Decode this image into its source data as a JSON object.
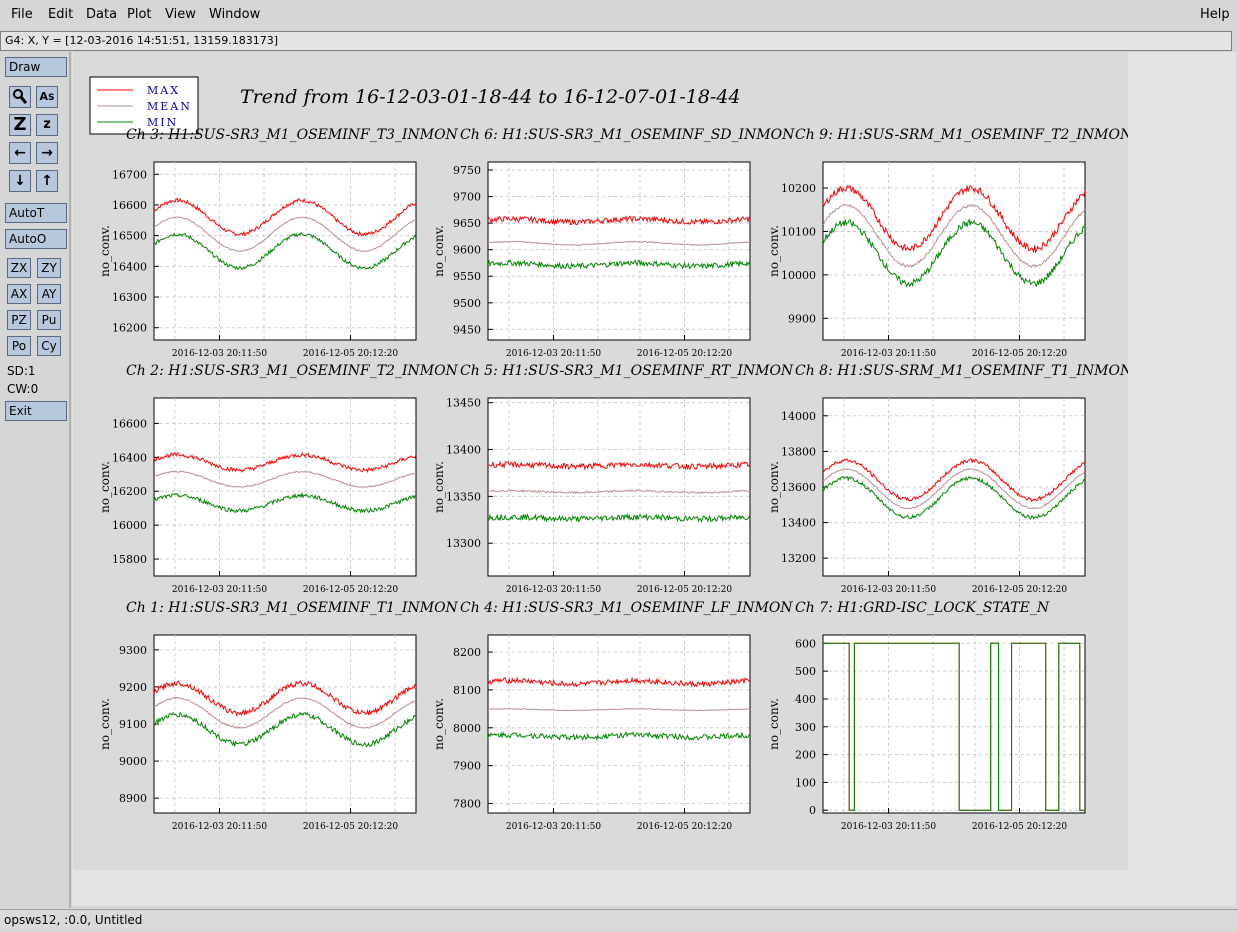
{
  "menu": {
    "file": "File",
    "edit": "Edit",
    "data": "Data",
    "plot": "Plot",
    "view": "View",
    "window": "Window",
    "help": "Help"
  },
  "coord_readout": "G4: X, Y = [12-03-2016 14:51:51, 13159.183173]",
  "toolbar": {
    "draw": "Draw",
    "autot": "AutoT",
    "autoo": "AutoO",
    "zx": "ZX",
    "zy": "ZY",
    "ax": "AX",
    "ay": "AY",
    "pz": "PZ",
    "pu": "Pu",
    "po": "Po",
    "cy": "Cy",
    "sd": "SD:1",
    "cw": "CW:0",
    "exit": "Exit",
    "icons": [
      "zoom-tool-icon",
      "text-tool-icon",
      "zoom-in-icon",
      "zoom-out-icon",
      "pan-left-icon",
      "pan-right-icon",
      "pan-down-icon",
      "pan-up-icon"
    ]
  },
  "status": "opsws12, :0.0, Untitled",
  "colors": {
    "max": "#ff0000",
    "mean": "#bc8f8f",
    "min": "#008800",
    "legend_text": "#0000cc"
  },
  "plot_title": "Trend from 16-12-03-01-18-44 to 16-12-07-01-18-44",
  "legend": [
    "MAX",
    "MEAN",
    "MIN"
  ],
  "chart_data": [
    {
      "type": "line",
      "title": "Ch 3: H1:SUS-SR3_M1_OSEMINF_T3_INMON",
      "ylabel": "no_conv.",
      "xtick_labels": [
        "2016-12-03 20:11:50",
        "2016-12-05 20:12:20"
      ],
      "yticks": [
        16200,
        16300,
        16400,
        16500,
        16600,
        16700
      ],
      "ylim": [
        16160,
        16740
      ],
      "grid": true,
      "series": [
        {
          "name": "MAX",
          "base": 16560,
          "amp": 55,
          "noise": 6
        },
        {
          "name": "MEAN",
          "base": 16505,
          "amp": 55,
          "noise": 2
        },
        {
          "name": "MIN",
          "base": 16450,
          "amp": 55,
          "noise": 6
        }
      ]
    },
    {
      "type": "line",
      "title": "Ch 6: H1:SUS-SR3_M1_OSEMINF_SD_INMON",
      "ylabel": "no_conv.",
      "xtick_labels": [
        "2016-12-03 20:11:50",
        "2016-12-05 20:12:20"
      ],
      "yticks": [
        9450,
        9500,
        9550,
        9600,
        9650,
        9700,
        9750
      ],
      "ylim": [
        9430,
        9765
      ],
      "grid": true,
      "series": [
        {
          "name": "MAX",
          "base": 9655,
          "amp": 3,
          "noise": 5
        },
        {
          "name": "MEAN",
          "base": 9612,
          "amp": 3,
          "noise": 1
        },
        {
          "name": "MIN",
          "base": 9572,
          "amp": 3,
          "noise": 5
        }
      ]
    },
    {
      "type": "line",
      "title": "Ch 9: H1:SUS-SRM_M1_OSEMINF_T2_INMON",
      "ylabel": "no_conv.",
      "xtick_labels": [
        "2016-12-03 20:11:50",
        "2016-12-05 20:12:20"
      ],
      "yticks": [
        9900,
        10000,
        10100,
        10200
      ],
      "ylim": [
        9850,
        10260
      ],
      "grid": true,
      "series": [
        {
          "name": "MAX",
          "base": 10130,
          "amp": 70,
          "noise": 8
        },
        {
          "name": "MEAN",
          "base": 10090,
          "amp": 70,
          "noise": 3
        },
        {
          "name": "MIN",
          "base": 10050,
          "amp": 70,
          "noise": 8
        }
      ]
    },
    {
      "type": "line",
      "title": "Ch 2: H1:SUS-SR3_M1_OSEMINF_T2_INMON",
      "ylabel": "no_conv.",
      "xtick_labels": [
        "2016-12-03 20:11:50",
        "2016-12-05 20:12:20"
      ],
      "yticks": [
        15800,
        16000,
        16200,
        16400,
        16600
      ],
      "ylim": [
        15700,
        16750
      ],
      "grid": true,
      "series": [
        {
          "name": "MAX",
          "base": 16370,
          "amp": 45,
          "noise": 12
        },
        {
          "name": "MEAN",
          "base": 16270,
          "amp": 45,
          "noise": 4
        },
        {
          "name": "MIN",
          "base": 16130,
          "amp": 45,
          "noise": 12
        }
      ]
    },
    {
      "type": "line",
      "title": "Ch 5: H1:SUS-SR3_M1_OSEMINF_RT_INMON",
      "ylabel": "no_conv.",
      "xtick_labels": [
        "2016-12-03 20:11:50",
        "2016-12-05 20:12:20"
      ],
      "yticks": [
        13300,
        13350,
        13400,
        13450
      ],
      "ylim": [
        13265,
        13455
      ],
      "grid": true,
      "series": [
        {
          "name": "MAX",
          "base": 13383,
          "amp": 1,
          "noise": 3
        },
        {
          "name": "MEAN",
          "base": 13355,
          "amp": 1,
          "noise": 1
        },
        {
          "name": "MIN",
          "base": 13327,
          "amp": 1,
          "noise": 3
        }
      ]
    },
    {
      "type": "line",
      "title": "Ch 8: H1:SUS-SRM_M1_OSEMINF_T1_INMON",
      "ylabel": "no_conv.",
      "xtick_labels": [
        "2016-12-03 20:11:50",
        "2016-12-05 20:12:20"
      ],
      "yticks": [
        13200,
        13400,
        13600,
        13800,
        14000
      ],
      "ylim": [
        13100,
        14100
      ],
      "grid": true,
      "series": [
        {
          "name": "MAX",
          "base": 13640,
          "amp": 110,
          "noise": 10
        },
        {
          "name": "MEAN",
          "base": 13590,
          "amp": 110,
          "noise": 4
        },
        {
          "name": "MIN",
          "base": 13540,
          "amp": 110,
          "noise": 10
        }
      ]
    },
    {
      "type": "line",
      "title": "Ch 1: H1:SUS-SR3_M1_OSEMINF_T1_INMON",
      "ylabel": "no_conv.",
      "xtick_labels": [
        "2016-12-03 20:11:50",
        "2016-12-05 20:12:20"
      ],
      "yticks": [
        8900,
        9000,
        9100,
        9200,
        9300
      ],
      "ylim": [
        8860,
        9340
      ],
      "grid": true,
      "series": [
        {
          "name": "MAX",
          "base": 9170,
          "amp": 40,
          "noise": 7
        },
        {
          "name": "MEAN",
          "base": 9130,
          "amp": 40,
          "noise": 2
        },
        {
          "name": "MIN",
          "base": 9085,
          "amp": 40,
          "noise": 7
        }
      ]
    },
    {
      "type": "line",
      "title": "Ch 4: H1:SUS-SR3_M1_OSEMINF_LF_INMON",
      "ylabel": "no_conv.",
      "xtick_labels": [
        "2016-12-03 20:11:50",
        "2016-12-05 20:12:20"
      ],
      "yticks": [
        7800,
        7900,
        8000,
        8100,
        8200
      ],
      "ylim": [
        7775,
        8245
      ],
      "grid": true,
      "series": [
        {
          "name": "MAX",
          "base": 8120,
          "amp": 5,
          "noise": 7
        },
        {
          "name": "MEAN",
          "base": 8048,
          "amp": 2,
          "noise": 1
        },
        {
          "name": "MIN",
          "base": 7978,
          "amp": 3,
          "noise": 7
        }
      ]
    },
    {
      "type": "line",
      "title": "Ch 7: H1:GRD-ISC_LOCK_STATE_N",
      "ylabel": "no_conv.",
      "xtick_labels": [
        "2016-12-03 20:11:50",
        "2016-12-05 20:12:20"
      ],
      "yticks": [
        0,
        100,
        200,
        300,
        400,
        500,
        600
      ],
      "ylim": [
        -10,
        630
      ],
      "grid": true,
      "series": [
        {
          "name": "MAX",
          "step": true
        },
        {
          "name": "MIN",
          "step": true
        }
      ]
    }
  ]
}
